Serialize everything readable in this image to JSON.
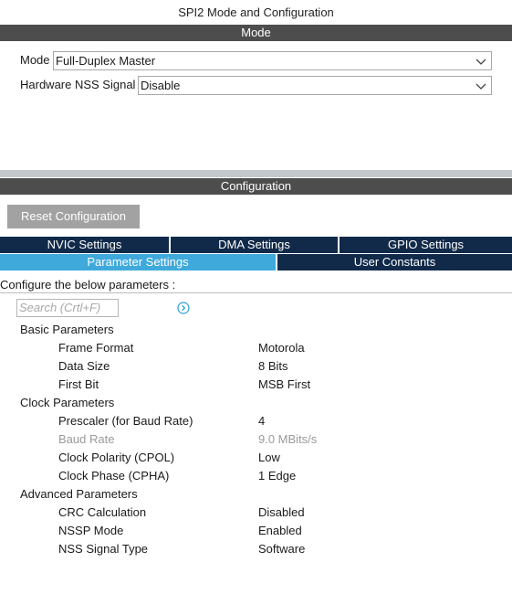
{
  "window_title": "SPI2 Mode and Configuration",
  "mode_section": {
    "header": "Mode",
    "mode_label": "Mode",
    "mode_value": "Full-Duplex Master",
    "nss_label": "Hardware NSS Signal",
    "nss_value": "Disable"
  },
  "config_section": {
    "header": "Configuration",
    "reset_button": "Reset Configuration",
    "tabs_row1": [
      "NVIC Settings",
      "DMA Settings",
      "GPIO Settings"
    ],
    "tabs_row2": [
      "Parameter Settings",
      "User Constants"
    ],
    "active_tab": "Parameter Settings",
    "hint": "Configure the below parameters :",
    "search_placeholder": "Search (Crtl+F)"
  },
  "parameters": {
    "basic": {
      "title": "Basic Parameters",
      "frame_format": {
        "name": "Frame Format",
        "value": "Motorola"
      },
      "data_size": {
        "name": "Data Size",
        "value": "8 Bits"
      },
      "first_bit": {
        "name": "First Bit",
        "value": "MSB First"
      }
    },
    "clock": {
      "title": "Clock Parameters",
      "prescaler": {
        "name": "Prescaler (for Baud Rate)",
        "value": "4"
      },
      "baud_rate": {
        "name": "Baud Rate",
        "value": "9.0 MBits/s"
      },
      "cpol": {
        "name": "Clock Polarity (CPOL)",
        "value": "Low"
      },
      "cpha": {
        "name": "Clock Phase (CPHA)",
        "value": "1 Edge"
      }
    },
    "advanced": {
      "title": "Advanced Parameters",
      "crc": {
        "name": "CRC Calculation",
        "value": "Disabled"
      },
      "nssp": {
        "name": "NSSP Mode",
        "value": "Enabled"
      },
      "nss_type": {
        "name": "NSS Signal Type",
        "value": "Software"
      }
    }
  },
  "colors": {
    "header_bg": "#4d4d4d",
    "tab_bg": "#112a4a",
    "tab_active_bg": "#3fa9dc",
    "reset_bg": "#a2a2a2"
  }
}
